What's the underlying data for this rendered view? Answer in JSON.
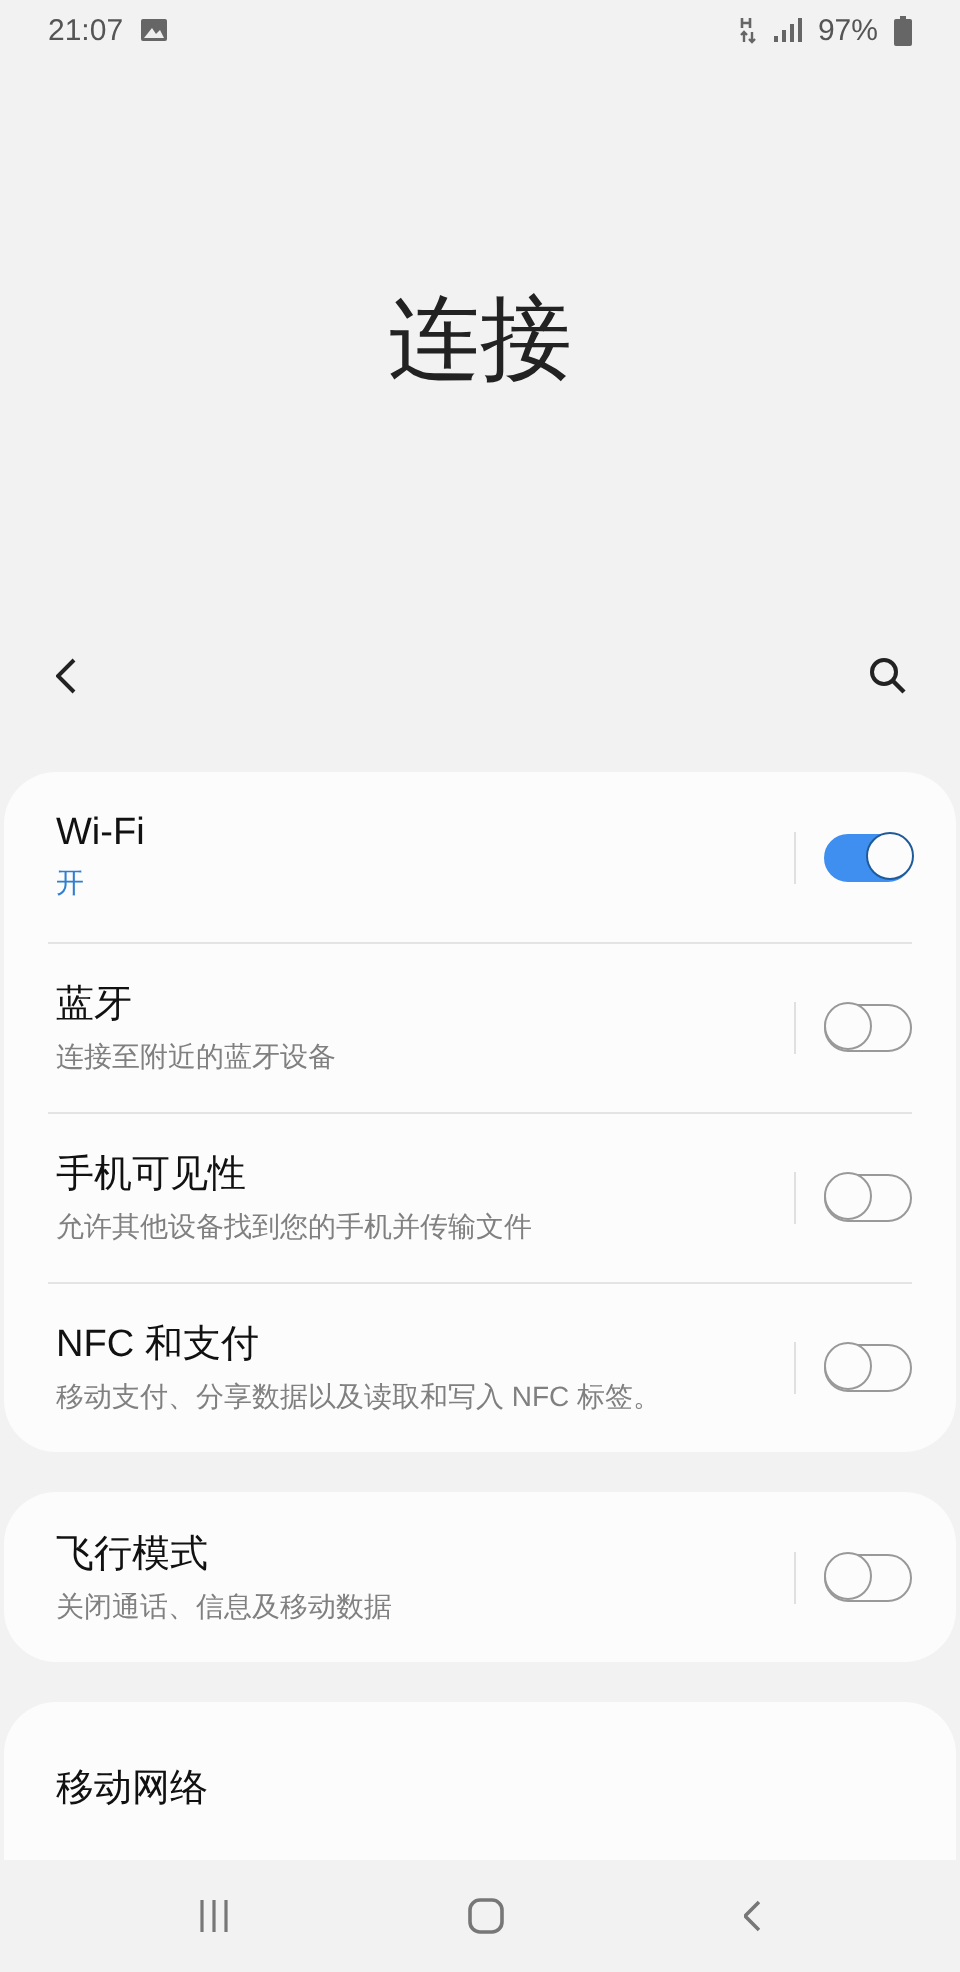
{
  "status_bar": {
    "time": "21:07",
    "battery": "97%"
  },
  "title": "连接",
  "groups": [
    {
      "items": [
        {
          "kind": "toggle",
          "title": "Wi-Fi",
          "status": "开",
          "on": true
        },
        {
          "kind": "toggle",
          "title": "蓝牙",
          "summary": "连接至附近的蓝牙设备",
          "on": false
        },
        {
          "kind": "toggle",
          "title": "手机可见性",
          "summary": "允许其他设备找到您的手机并传输文件",
          "on": false
        },
        {
          "kind": "toggle",
          "title": "NFC 和支付",
          "summary": "移动支付、分享数据以及读取和写入 NFC 标签。",
          "on": false
        }
      ]
    },
    {
      "items": [
        {
          "kind": "toggle",
          "title": "飞行模式",
          "summary": "关闭通话、信息及移动数据",
          "on": false
        }
      ]
    },
    {
      "items": [
        {
          "kind": "link",
          "title": "移动网络"
        }
      ]
    }
  ]
}
